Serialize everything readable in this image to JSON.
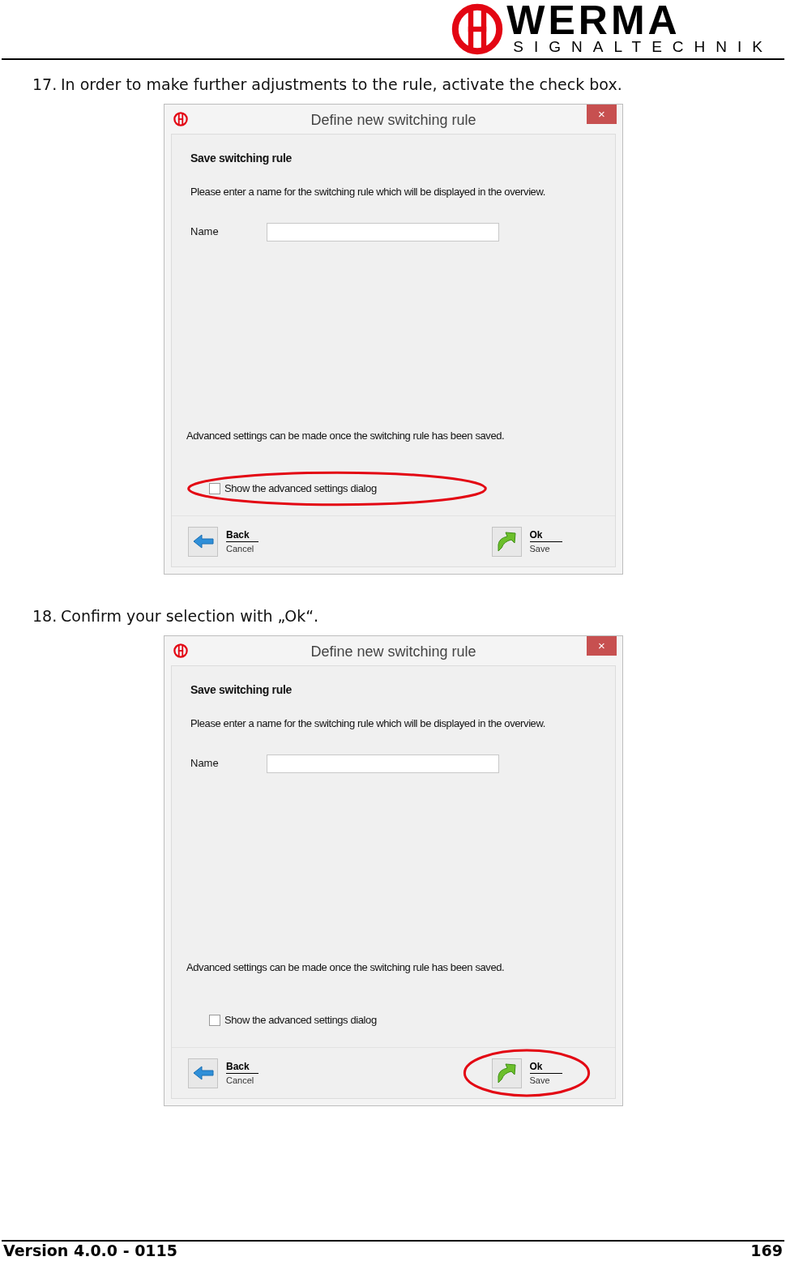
{
  "header": {
    "brand": "WERMA",
    "tagline": "SIGNALTECHNIK"
  },
  "steps": [
    {
      "number": "17.",
      "text": "In order to make further adjustments to the rule, activate the check box.",
      "dialog": {
        "title": "Define new switching rule",
        "close": "×",
        "heading": "Save switching rule",
        "instruction": "Please enter a name for the switching rule which will be displayed in the overview.",
        "name_label": "Name",
        "note": "Advanced settings can be made once the switching rule has been saved.",
        "checkbox": {
          "label": "Show the advanced settings dialog",
          "checked": false,
          "highlighted": true
        },
        "back": {
          "label": "Back",
          "sub": "Cancel"
        },
        "ok": {
          "label": "Ok",
          "sub": "Save",
          "highlighted": false
        }
      }
    },
    {
      "number": "18.",
      "text": "Confirm your selection with „Ok“.",
      "dialog": {
        "title": "Define new switching rule",
        "close": "×",
        "heading": "Save switching rule",
        "instruction": "Please enter a name for the switching rule which will be displayed in the overview.",
        "name_label": "Name",
        "note": "Advanced settings can be made once the switching rule has been saved.",
        "checkbox": {
          "label": "Show the advanced settings dialog",
          "checked": false,
          "highlighted": false
        },
        "back": {
          "label": "Back",
          "sub": "Cancel"
        },
        "ok": {
          "label": "Ok",
          "sub": "Save",
          "highlighted": true
        }
      }
    }
  ],
  "footer": {
    "version": "Version 4.0.0 - 0115",
    "page": "169"
  }
}
